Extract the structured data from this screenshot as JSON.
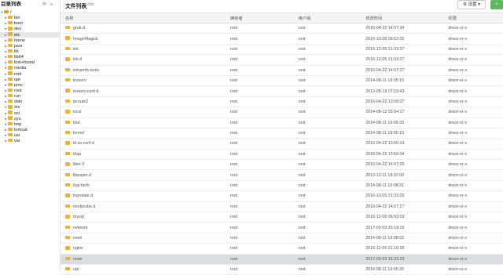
{
  "sidebar": {
    "title": "目录列表",
    "tree_items": [
      {
        "label": "/",
        "open": true,
        "indent": 0
      },
      {
        "label": "bin",
        "indent": 1
      },
      {
        "label": "boot",
        "indent": 1
      },
      {
        "label": "dev",
        "indent": 1
      },
      {
        "label": "etc",
        "indent": 1,
        "selected": true
      },
      {
        "label": "home",
        "indent": 1
      },
      {
        "label": "java",
        "indent": 1
      },
      {
        "label": "lib",
        "indent": 1
      },
      {
        "label": "lib64",
        "indent": 1
      },
      {
        "label": "lost+found",
        "indent": 1
      },
      {
        "label": "media",
        "indent": 1
      },
      {
        "label": "mnt",
        "indent": 1
      },
      {
        "label": "opt",
        "indent": 1
      },
      {
        "label": "proc",
        "indent": 1
      },
      {
        "label": "root",
        "indent": 1
      },
      {
        "label": "run",
        "indent": 1
      },
      {
        "label": "sbin",
        "indent": 1
      },
      {
        "label": "srv",
        "indent": 1
      },
      {
        "label": "ssl",
        "indent": 1
      },
      {
        "label": "sys",
        "indent": 1
      },
      {
        "label": "tmp",
        "indent": 1
      },
      {
        "label": "tomcat",
        "indent": 1
      },
      {
        "label": "usr",
        "indent": 1
      },
      {
        "label": "var",
        "indent": 1
      }
    ]
  },
  "header": {
    "title": "文件列表",
    "path": "/etc",
    "settings_label": "设置",
    "add_label": "+"
  },
  "table": {
    "columns": [
      "名称",
      "拥有者",
      "用户组",
      "修改时间",
      "权限"
    ],
    "rows": [
      {
        "name": "grub.d",
        "owner": "root",
        "group": "root",
        "mtime": "2016-04-22 14:07:34",
        "perm": "drwxr-xr-x"
      },
      {
        "name": "ImageMagick",
        "owner": "root",
        "group": "root",
        "mtime": "2016-12-06 06:52:02",
        "perm": "drwxr-xr-x"
      },
      {
        "name": "init",
        "owner": "root",
        "group": "root",
        "mtime": "2016-12-05 21:33:27",
        "perm": "drwxr-xr-x"
      },
      {
        "name": "init.d",
        "owner": "root",
        "group": "root",
        "mtime": "2016-12-05 21:33:27",
        "perm": "drwxr-xr-x"
      },
      {
        "name": "initramfs-tools",
        "owner": "root",
        "group": "root",
        "mtime": "2016-04-22 14:07:27",
        "perm": "drwxr-xr-x"
      },
      {
        "name": "insserv",
        "owner": "root",
        "group": "root",
        "mtime": "2014-08-11 19:05:19",
        "perm": "drwxr-xr-x"
      },
      {
        "name": "insserv.conf.d",
        "owner": "root",
        "group": "root",
        "mtime": "2013-05-19 07:23:43",
        "perm": "drwxr-xr-x"
      },
      {
        "name": "iproute2",
        "owner": "root",
        "group": "root",
        "mtime": "2016-04-22 13:56:07",
        "perm": "drwxr-xr-x"
      },
      {
        "name": "iscsi",
        "owner": "root",
        "group": "root",
        "mtime": "2014-08-12 03:04:17",
        "perm": "drwxr-xr-x"
      },
      {
        "name": "kbd",
        "owner": "root",
        "group": "root",
        "mtime": "2014-08-11 19:09:20",
        "perm": "drwxr-xr-x"
      },
      {
        "name": "kernel",
        "owner": "root",
        "group": "root",
        "mtime": "2014-08-11 19:05:19",
        "perm": "drwxr-xr-x"
      },
      {
        "name": "ld.so.conf.d",
        "owner": "root",
        "group": "root",
        "mtime": "2016-04-22 13:55:13",
        "perm": "drwxr-xr-x"
      },
      {
        "name": "ldap",
        "owner": "root",
        "group": "root",
        "mtime": "2016-04-22 13:56:04",
        "perm": "drwxr-xr-x"
      },
      {
        "name": "libnl-3",
        "owner": "root",
        "group": "root",
        "mtime": "2016-04-22 14:07:29",
        "perm": "drwxr-xr-x"
      },
      {
        "name": "libpaper.d",
        "owner": "root",
        "group": "root",
        "mtime": "2013-12-11 18:32:00",
        "perm": "drwxr-xr-x"
      },
      {
        "name": "logcheck",
        "owner": "root",
        "group": "root",
        "mtime": "2014-08-11 19:08:31",
        "perm": "drwxr-xr-x"
      },
      {
        "name": "logrotate.d",
        "owner": "root",
        "group": "root",
        "mtime": "2016-12-05 21:33:26",
        "perm": "drwxr-xr-x"
      },
      {
        "name": "modprobe.d",
        "owner": "root",
        "group": "root",
        "mtime": "2016-04-22 14:07:27",
        "perm": "drwxr-xr-x"
      },
      {
        "name": "mysql",
        "owner": "root",
        "group": "root",
        "mtime": "2016-12-06 06:52:03",
        "perm": "drwxr-xr-x"
      },
      {
        "name": "network",
        "owner": "root",
        "group": "root",
        "mtime": "2017-02-03 15:19:19",
        "perm": "drwxr-xr-x"
      },
      {
        "name": "newt",
        "owner": "root",
        "group": "root",
        "mtime": "2014-08-11 19:08:53",
        "perm": "drwxr-xr-x"
      },
      {
        "name": "nginx",
        "owner": "root",
        "group": "root",
        "mtime": "2016-12-05 21:10:26",
        "perm": "drwxr-xr-x"
      },
      {
        "name": "node",
        "owner": "root",
        "group": "root",
        "mtime": "2017-02-03 15:33:23",
        "perm": "drwxr-xr-x",
        "selected": true
      },
      {
        "name": "opt",
        "owner": "root",
        "group": "root",
        "mtime": "2014-08-11 19:05:26",
        "perm": "drwxr-xr-x"
      }
    ]
  },
  "colors": {
    "folder": "#f0b133",
    "selected_row": "#dcdde3",
    "accent_green": "#5cb85c"
  },
  "icons": {
    "folder": "folder-icon",
    "settings": "gear-icon",
    "collapse": "double-chevron-left-icon",
    "refresh": "refresh-icon"
  }
}
